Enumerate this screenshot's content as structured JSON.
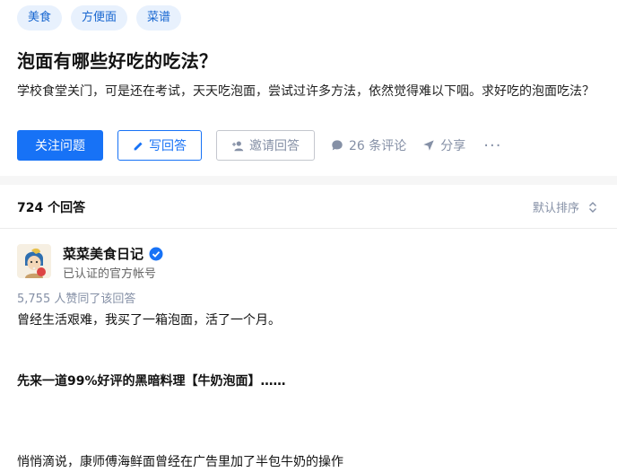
{
  "tags": [
    "美食",
    "方便面",
    "菜谱"
  ],
  "question": {
    "title": "泡面有哪些好吃的吃法？",
    "description": "学校食堂关门，可是还在考试，天天吃泡面，尝试过许多方法，依然觉得难以下咽。求好吃的泡面吃法？"
  },
  "actions": {
    "follow": "关注问题",
    "write": "写回答",
    "invite": "邀请回答",
    "comments": "26 条评论",
    "share": "分享",
    "more": "···"
  },
  "answers": {
    "count": "724 个回答",
    "sort": "默认排序"
  },
  "answer": {
    "author": "菜菜美食日记",
    "author_desc": "已认证的官方帐号",
    "votes": "5,755 人赞同了该回答",
    "p1": "曾经生活艰难，我买了一箱泡面，活了一个月。",
    "p2": "先来一道99%好评的黑暗料理【牛奶泡面】……",
    "p3": "悄悄滴说，康师傅海鲜面曾经在广告里加了半包牛奶的操作"
  },
  "colors": {
    "primary": "#1772f6",
    "muted": "#8590a6",
    "tag_bg": "#e8f1fd"
  }
}
